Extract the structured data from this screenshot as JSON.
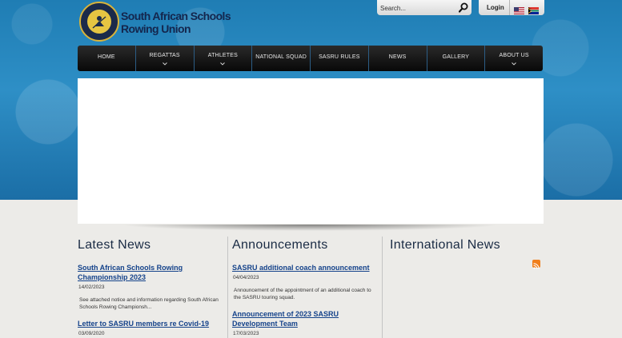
{
  "site": {
    "title_line1": "South African Schools",
    "title_line2": "Rowing Union"
  },
  "search": {
    "placeholder": "Search..."
  },
  "login": {
    "label": "Login"
  },
  "nav": {
    "items": [
      "HOME",
      "REGATTAS",
      "ATHLETES",
      "NATIONAL SQUAD",
      "SASRU RULES",
      "NEWS",
      "GALLERY",
      "ABOUT US"
    ]
  },
  "latest_news": {
    "heading": "Latest News",
    "items": [
      {
        "title": "South African Schools Rowing Championship 2023",
        "date": "14/02/2023",
        "summary": "See attached notice and information regarding South African Schools Rowing Championsh..."
      },
      {
        "title": "Letter to SASRU members re Covid-19",
        "date": "03/09/2020"
      }
    ]
  },
  "announcements": {
    "heading": "Announcements",
    "items": [
      {
        "title": "SASRU additional coach announcement",
        "date": "04/04/2023",
        "summary": "Announcement of the appointment of an additional coach to the SASRU touring squad."
      },
      {
        "title": "Announcement of 2023 SASRU Development Team",
        "date": "17/03/2023"
      }
    ]
  },
  "international_news": {
    "heading": "International News"
  },
  "colors": {
    "accent_blue": "#2e8fc6",
    "link": "#14428a",
    "heading": "#1a2b44",
    "nav_bg": "#080808",
    "rss": "#f07f1d"
  }
}
